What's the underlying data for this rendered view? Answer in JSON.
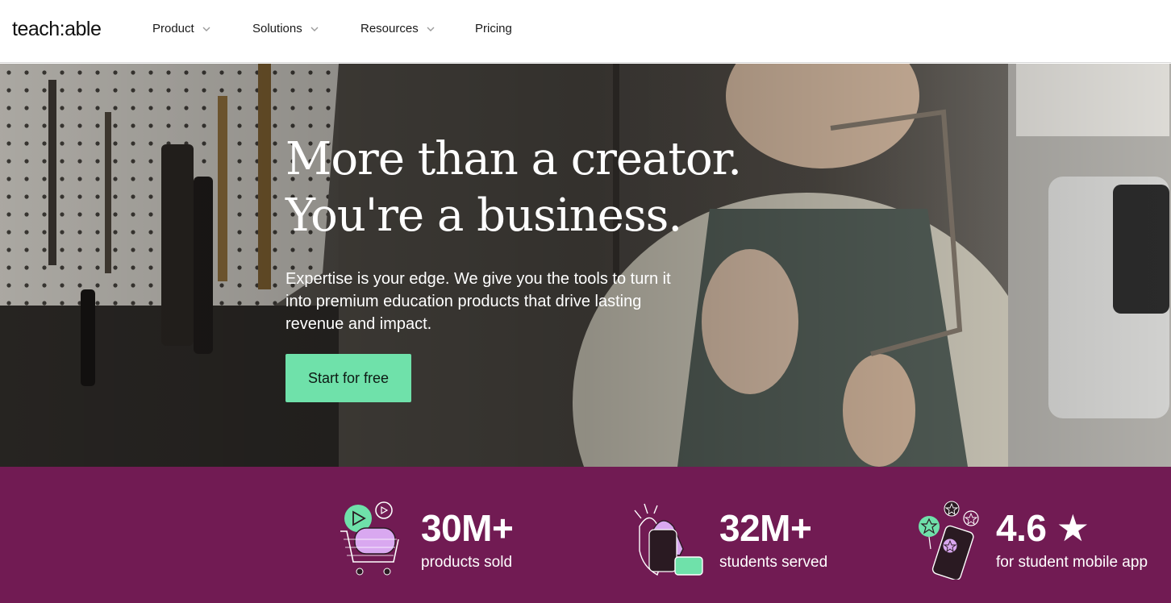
{
  "brand": {
    "logo_text": "teach:able"
  },
  "nav": {
    "items": [
      {
        "label": "Product",
        "has_dropdown": true
      },
      {
        "label": "Solutions",
        "has_dropdown": true
      },
      {
        "label": "Resources",
        "has_dropdown": true
      },
      {
        "label": "Pricing",
        "has_dropdown": false
      }
    ]
  },
  "hero": {
    "title_line1": "More than a creator.",
    "title_line2": "You're a business.",
    "subtitle": "Expertise is your edge. We give you the tools to turn it into premium education products that drive lasting revenue and impact.",
    "cta_label": "Start for free"
  },
  "stats": [
    {
      "value": "30M+",
      "label": "products sold",
      "icon": "shopping-cart-icon"
    },
    {
      "value": "32M+",
      "label": "students served",
      "icon": "clapping-hands-icon"
    },
    {
      "value": "4.6 ★",
      "label": "for student mobile app",
      "icon": "phone-stars-icon"
    }
  ],
  "colors": {
    "accent_green": "#6fe1aa",
    "stats_background": "#711b53",
    "icon_lilac": "#d9a8f0"
  }
}
